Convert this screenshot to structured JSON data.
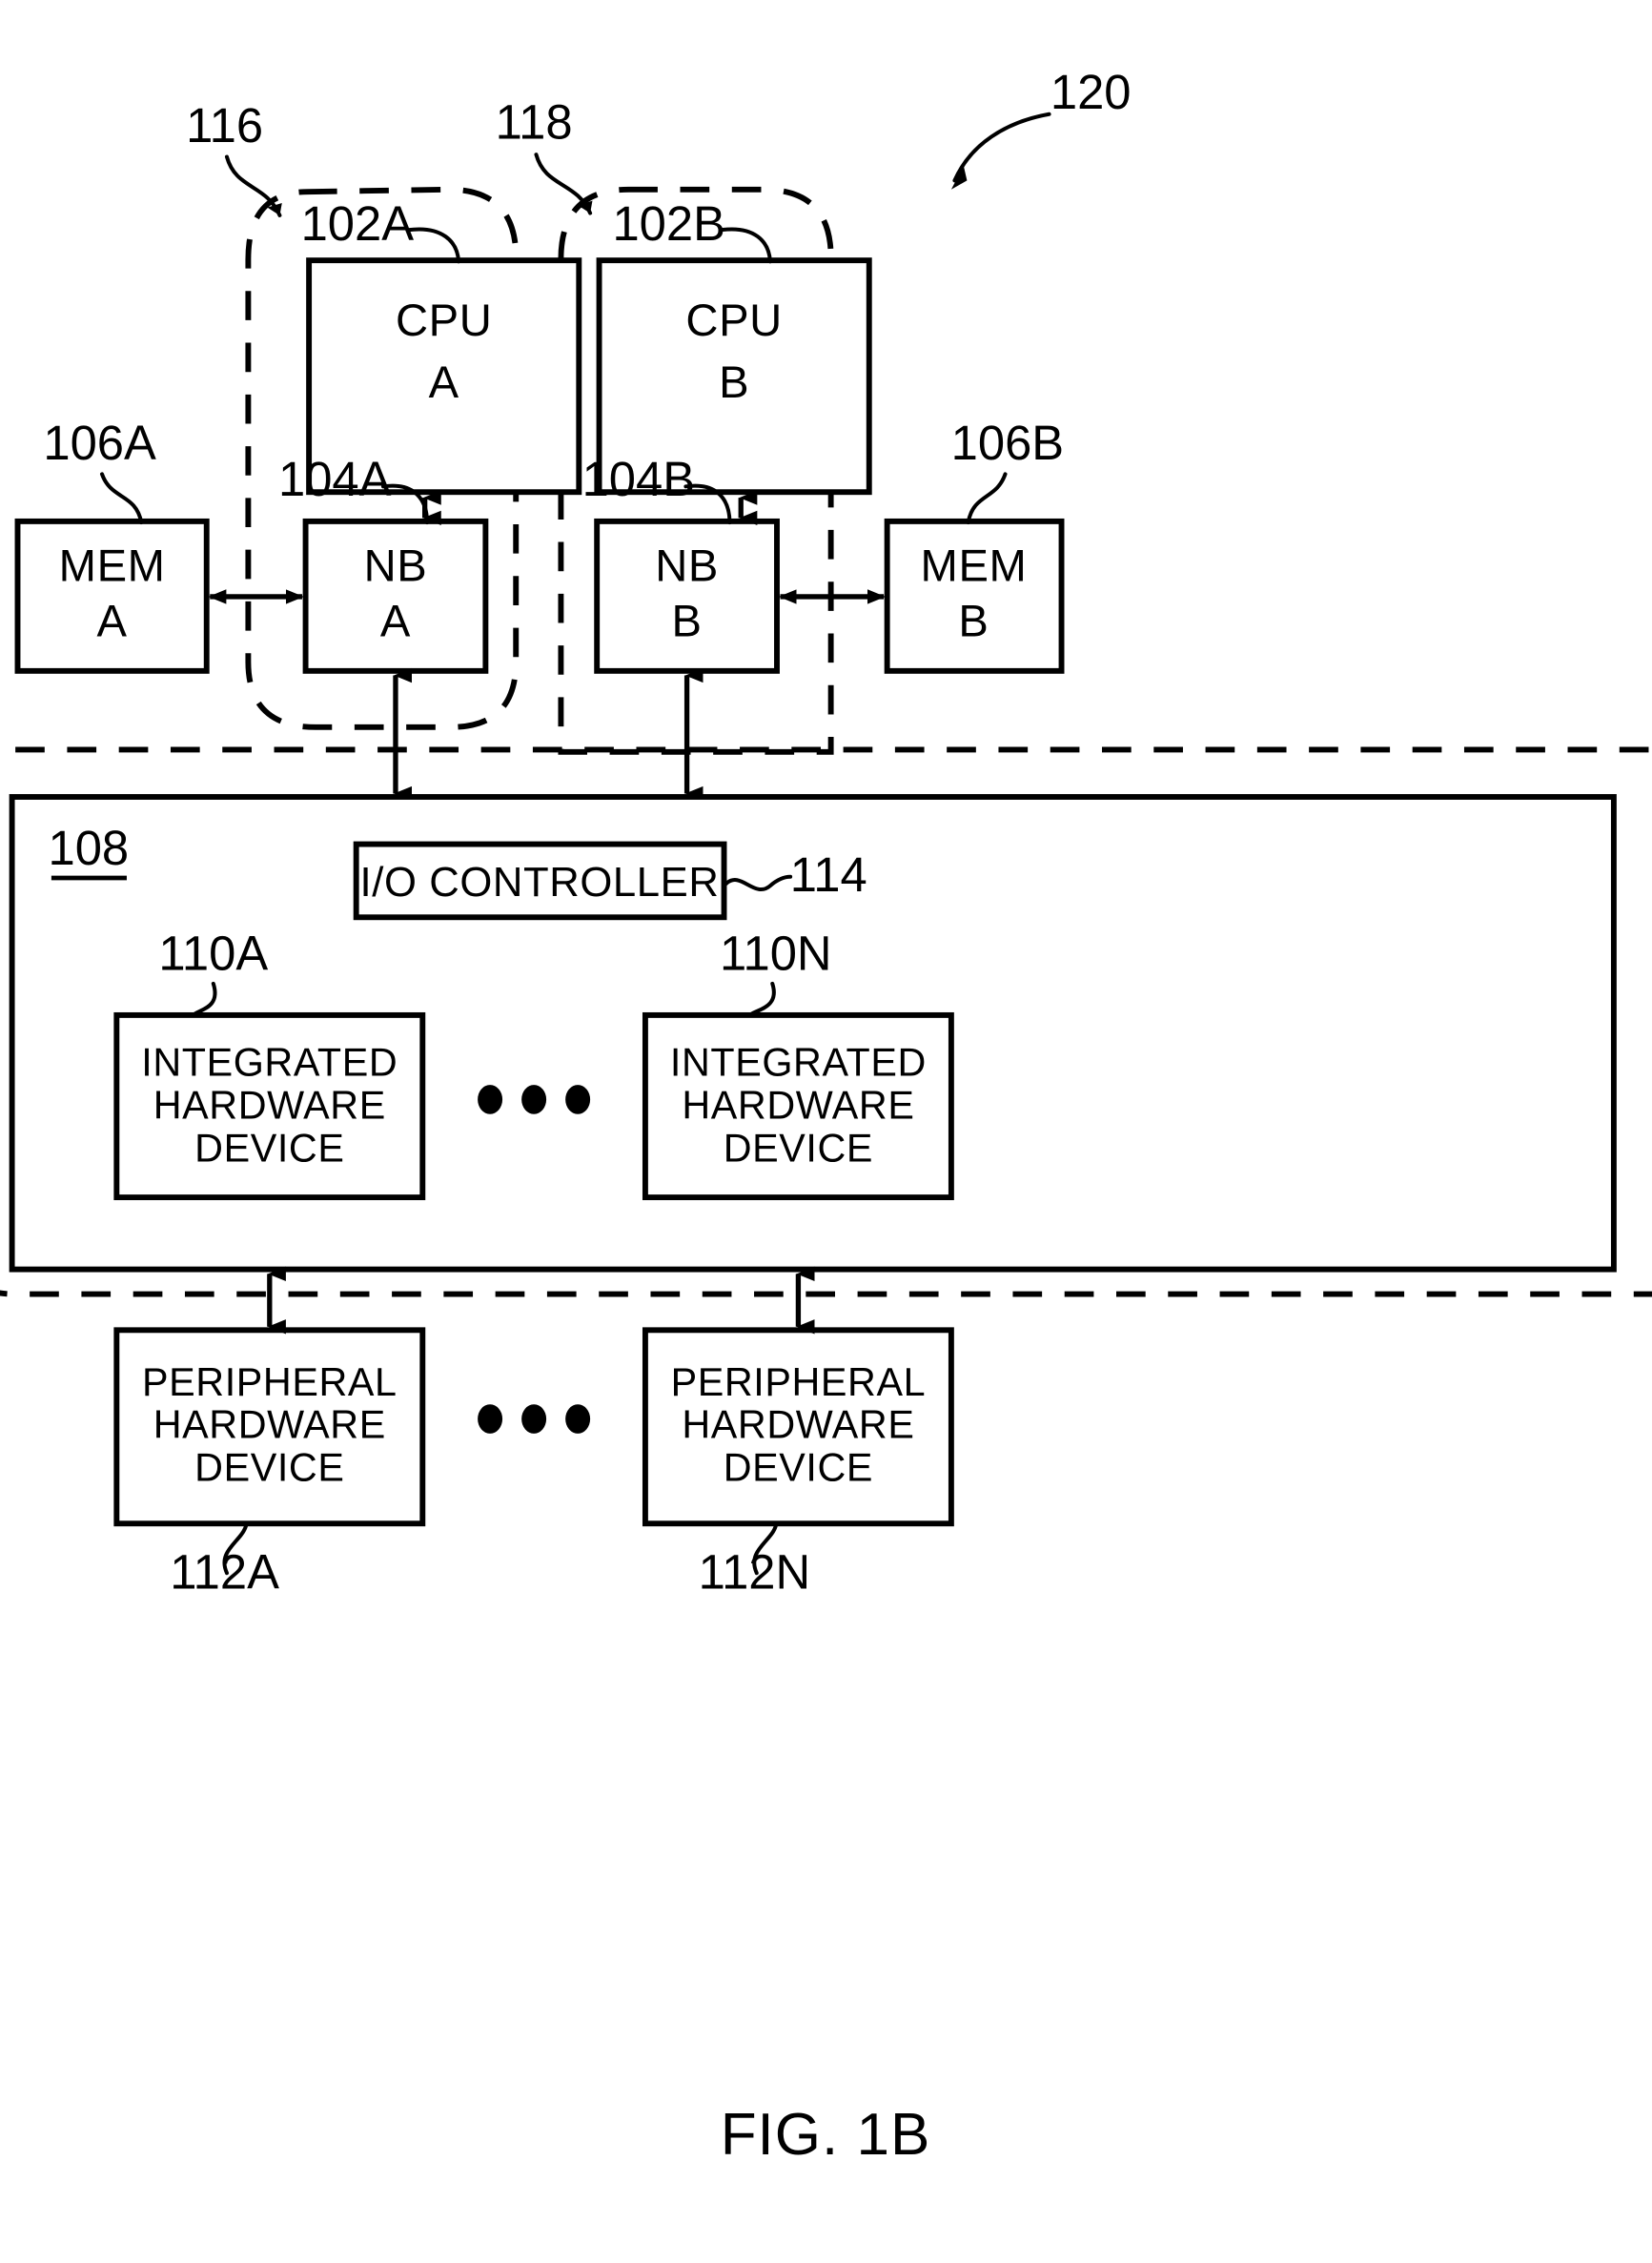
{
  "figure": {
    "caption": "FIG. 1B",
    "system_ref": "120"
  },
  "node_groups": [
    {
      "id": "package-a",
      "ref": "116",
      "nodes": [
        {
          "id": "cpu-a",
          "ref": "102A",
          "line1": "CPU",
          "line2": "A"
        },
        {
          "id": "nb-a",
          "ref": "104A",
          "line1": "NB",
          "line2": "A"
        }
      ]
    },
    {
      "id": "package-b",
      "ref": "118",
      "nodes": [
        {
          "id": "cpu-b",
          "ref": "102B",
          "line1": "CPU",
          "line2": "B"
        },
        {
          "id": "nb-b",
          "ref": "104B",
          "line1": "NB",
          "line2": "B"
        }
      ]
    }
  ],
  "memories": [
    {
      "id": "mem-a",
      "ref": "106A",
      "line1": "MEM",
      "line2": "A"
    },
    {
      "id": "mem-b",
      "ref": "106B",
      "line1": "MEM",
      "line2": "B"
    }
  ],
  "io_region": {
    "ref": "108",
    "controller": {
      "ref": "114",
      "label": "I/O CONTROLLER"
    },
    "integrated_devices": [
      {
        "id": "integrated-device-a",
        "ref": "110A",
        "line1": "INTEGRATED",
        "line2": "HARDWARE",
        "line3": "DEVICE"
      },
      {
        "id": "integrated-device-n",
        "ref": "110N",
        "line1": "INTEGRATED",
        "line2": "HARDWARE",
        "line3": "DEVICE"
      }
    ],
    "ellipsis": "• • •"
  },
  "peripheral_devices": [
    {
      "id": "peripheral-device-a",
      "ref": "112A",
      "line1": "PERIPHERAL",
      "line2": "HARDWARE",
      "line3": "DEVICE"
    },
    {
      "id": "peripheral-device-n",
      "ref": "112N",
      "line1": "PERIPHERAL",
      "line2": "HARDWARE",
      "line3": "DEVICE"
    }
  ],
  "colors": {
    "ink": "#000000",
    "paper": "#ffffff"
  }
}
